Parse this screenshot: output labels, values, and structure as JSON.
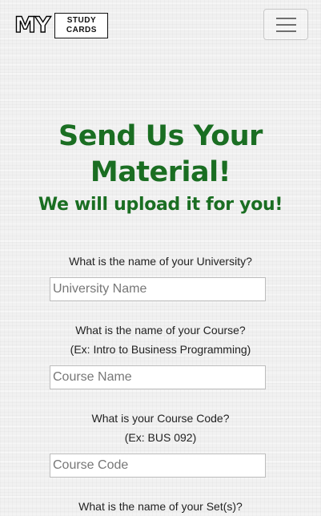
{
  "nav": {
    "logo_my": "MY",
    "logo_line1": "STUDY",
    "logo_line2": "CARDS"
  },
  "main": {
    "title": "Send Us Your Material!",
    "subtitle": "We will upload it for you!"
  },
  "form": {
    "university": {
      "label": "What is the name of your University?",
      "placeholder": "University Name"
    },
    "course": {
      "label": "What is the name of your Course?",
      "hint": "(Ex: Intro to Business Programming)",
      "placeholder": "Course Name"
    },
    "code": {
      "label": "What is your Course Code?",
      "hint": "(Ex: BUS 092)",
      "placeholder": "Course Code"
    },
    "sets": {
      "label": "What is the name of your Set(s)?"
    }
  },
  "colors": {
    "heading_green": "#1a6e22",
    "background": "#f1f1f1"
  }
}
